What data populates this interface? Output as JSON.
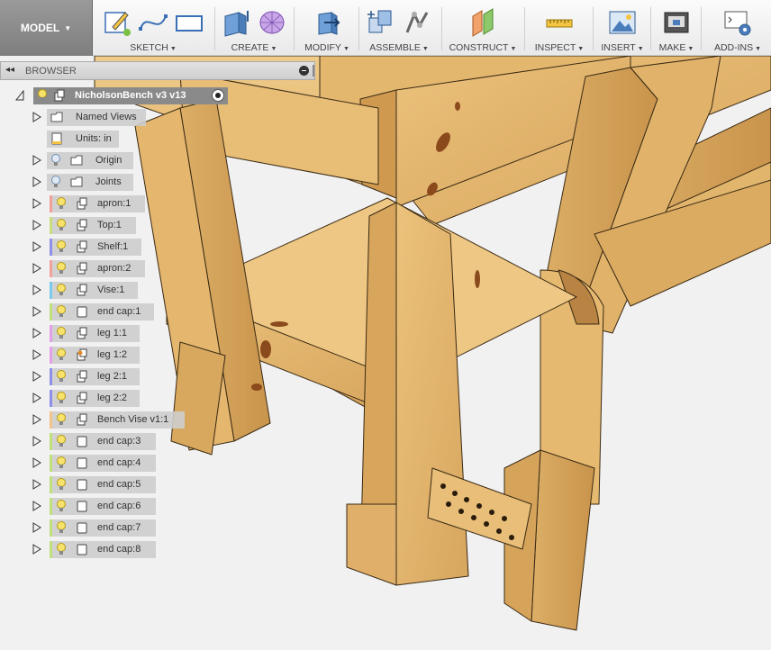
{
  "toolbar": {
    "workspace": "MODEL",
    "groups": [
      {
        "label": "SKETCH"
      },
      {
        "label": "CREATE"
      },
      {
        "label": "MODIFY"
      },
      {
        "label": "ASSEMBLE"
      },
      {
        "label": "CONSTRUCT"
      },
      {
        "label": "INSPECT"
      },
      {
        "label": "INSERT"
      },
      {
        "label": "MAKE"
      },
      {
        "label": "ADD-INS"
      }
    ]
  },
  "browser": {
    "title": "BROWSER",
    "root": {
      "label": "NicholsonBench v3 v13"
    },
    "items": [
      {
        "label": "Named Views",
        "icon": "folder-icon"
      },
      {
        "label": "Units: in",
        "icon": "document-icon"
      },
      {
        "label": "Origin",
        "icon": "folder-icon"
      },
      {
        "label": "Joints",
        "icon": "folder-icon"
      },
      {
        "label": "apron:1",
        "icon": "component-icon",
        "color": "#f2a09a"
      },
      {
        "label": "Top:1",
        "icon": "component-icon",
        "color": "#c8de7c"
      },
      {
        "label": "Shelf:1",
        "icon": "component-icon",
        "color": "#8f8ee8"
      },
      {
        "label": "apron:2",
        "icon": "component-icon",
        "color": "#f2a09a"
      },
      {
        "label": "Vise:1",
        "icon": "component-icon",
        "color": "#7ccbee"
      },
      {
        "label": "end cap:1",
        "icon": "body-icon",
        "color": "#bfe07a"
      },
      {
        "label": "leg 1:1",
        "icon": "component-icon",
        "color": "#e39fe8"
      },
      {
        "label": "leg 1:2",
        "icon": "component-icon",
        "color": "#e39fe8"
      },
      {
        "label": "leg 2:1",
        "icon": "component-icon",
        "color": "#8f8ee8"
      },
      {
        "label": "leg 2:2",
        "icon": "component-icon",
        "color": "#8f8ee8"
      },
      {
        "label": "Bench Vise v1:1",
        "icon": "component-icon",
        "color": "#f0c48a"
      },
      {
        "label": "end cap:3",
        "icon": "body-icon",
        "color": "#bfe07a"
      },
      {
        "label": "end cap:4",
        "icon": "body-icon",
        "color": "#bfe07a"
      },
      {
        "label": "end cap:5",
        "icon": "body-icon",
        "color": "#bfe07a"
      },
      {
        "label": "end cap:6",
        "icon": "body-icon",
        "color": "#bfe07a"
      },
      {
        "label": "end cap:7",
        "icon": "body-icon",
        "color": "#bfe07a"
      },
      {
        "label": "end cap:8",
        "icon": "body-icon",
        "color": "#bfe07a"
      }
    ]
  },
  "colors": {
    "wood_light": "#e6bb74",
    "wood_mid": "#d9a75c",
    "wood_dark": "#bf8a42",
    "viewport_bg": "#f1f1f1",
    "toolbar_bg": "#f4f4f4",
    "workspace_bg": "#8d8d8d"
  }
}
